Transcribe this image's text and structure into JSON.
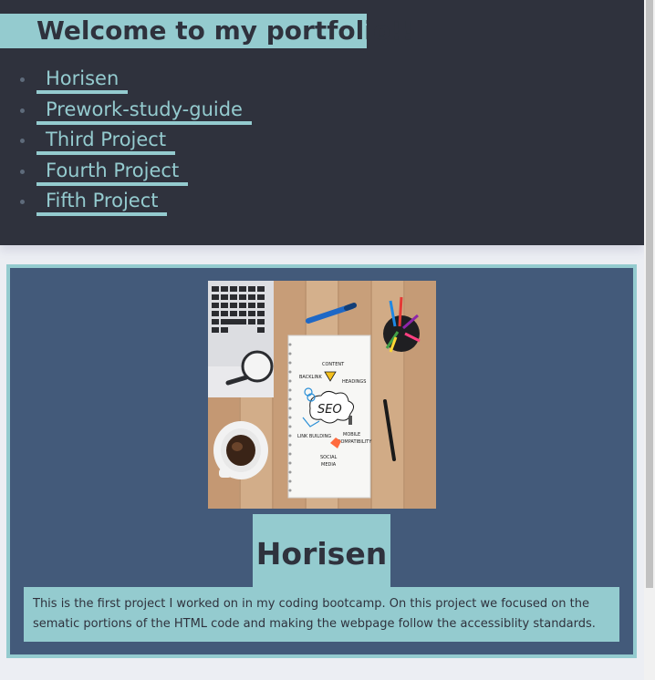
{
  "header": {
    "title": "Welcome to my portfolio!!",
    "nav": [
      {
        "label": "Horisen"
      },
      {
        "label": "Prework-study-guide"
      },
      {
        "label": "Third Project"
      },
      {
        "label": "Fourth Project"
      },
      {
        "label": "Fifth Project"
      }
    ]
  },
  "project": {
    "image_alt": "SEO notebook on wooden desk with laptop, coffee and markers",
    "image_words": {
      "content": "CONTENT",
      "backlink": "BACKLINK",
      "headings": "HEADINGS",
      "seo": "SEO",
      "link_building": "LINK BUILDING",
      "mobile": "MOBILE",
      "compatibility": "COMPATIBILITY",
      "social": "SOCIAL",
      "media": "MEDIA"
    },
    "title": "Horisen",
    "description": "This is the first project I worked on in my coding bootcamp. On this project we focused on the sematic portions of the HTML code and making the webpage follow the accessiblity standards."
  },
  "colors": {
    "header_bg": "#2f323d",
    "accent": "#94cbcf",
    "card_bg": "#435a7a",
    "page_bg": "#eceef3"
  }
}
